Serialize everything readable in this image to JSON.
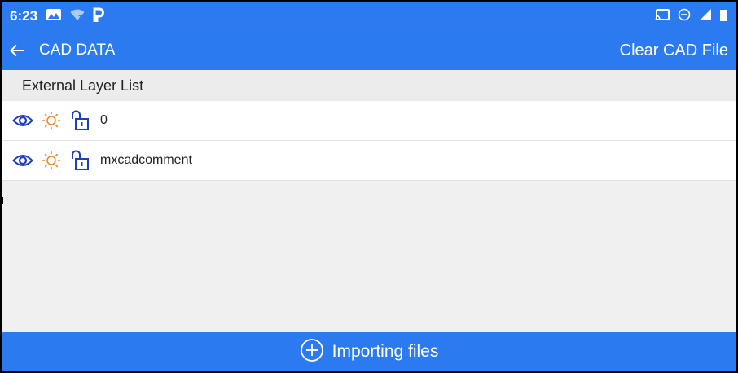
{
  "status_bar": {
    "time": "6:23",
    "icons_left": [
      "gallery-icon",
      "wifi-icon",
      "parking-icon"
    ],
    "icons_right": [
      "cast-icon",
      "do-not-disturb-icon",
      "signal-icon",
      "battery-icon"
    ]
  },
  "app_bar": {
    "title": "CAD DATA",
    "clear_label": "Clear CAD File"
  },
  "layers_section": {
    "header": "External Layer List",
    "items": [
      {
        "name": "0",
        "visible": true,
        "on": true,
        "locked": false
      },
      {
        "name": "mxcadcomment",
        "visible": true,
        "on": true,
        "locked": false
      }
    ]
  },
  "bottom_bar": {
    "label": "Importing files"
  },
  "colors": {
    "primary": "#2b7af0",
    "icon_blue": "#1c3fbf",
    "sun_orange": "#f08a24",
    "background": "#f0f0f0"
  }
}
